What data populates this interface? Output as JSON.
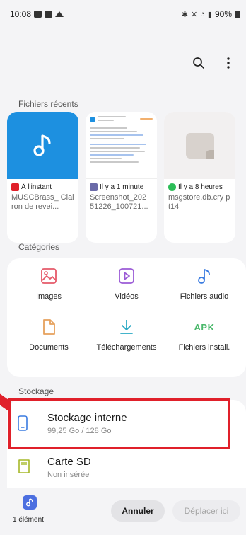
{
  "status_bar": {
    "time": "10:08",
    "battery": "90%"
  },
  "toolbar": {
    "search_icon": "search-icon",
    "more_icon": "more-vertical-icon"
  },
  "recent": {
    "title": "Fichiers récents",
    "items": [
      {
        "time_label": "À l'instant",
        "name": "MUSCBrass_ Clairon de revei...",
        "app": "mail",
        "app_color": "#e0202a",
        "thumb": "music-note-icon"
      },
      {
        "time_label": "Il y a 1 minute",
        "name": "Screenshot_202 51226_100721...",
        "app": "gallery",
        "app_color": "#6a6aa8",
        "thumb": "screenshot-thumbnail"
      },
      {
        "time_label": "Il y a 8 heures",
        "name": "msgstore.db.cry pt14",
        "app": "whatsapp",
        "app_color": "#2bbd57",
        "thumb": "file-icon"
      }
    ]
  },
  "categories": {
    "title": "Catégories",
    "items": [
      {
        "label": "Images",
        "icon": "image-icon",
        "color": "#e55a6a"
      },
      {
        "label": "Vidéos",
        "icon": "video-icon",
        "color": "#9b5bd6"
      },
      {
        "label": "Fichiers audio",
        "icon": "music-icon",
        "color": "#3a7be0"
      },
      {
        "label": "Documents",
        "icon": "document-icon",
        "color": "#e6a15c"
      },
      {
        "label": "Téléchargements",
        "icon": "download-icon",
        "color": "#2aa9c4"
      },
      {
        "label": "Fichiers install.",
        "icon": "apk-icon",
        "apk_text": "APK",
        "color": "#49b86a"
      }
    ]
  },
  "storage": {
    "title": "Stockage",
    "items": [
      {
        "title": "Stockage interne",
        "subtitle": "99,25 Go / 128 Go",
        "icon": "phone-storage-icon",
        "color": "#3a7be0"
      },
      {
        "title": "Carte SD",
        "subtitle": "Non insérée",
        "icon": "sd-card-icon",
        "color": "#a6b829"
      }
    ]
  },
  "selection": {
    "count": "1 élément"
  },
  "actions": {
    "cancel": "Annuler",
    "move": "Déplacer ici"
  },
  "colors": {
    "highlight": "#e0202a",
    "accent": "#1d90e0"
  }
}
